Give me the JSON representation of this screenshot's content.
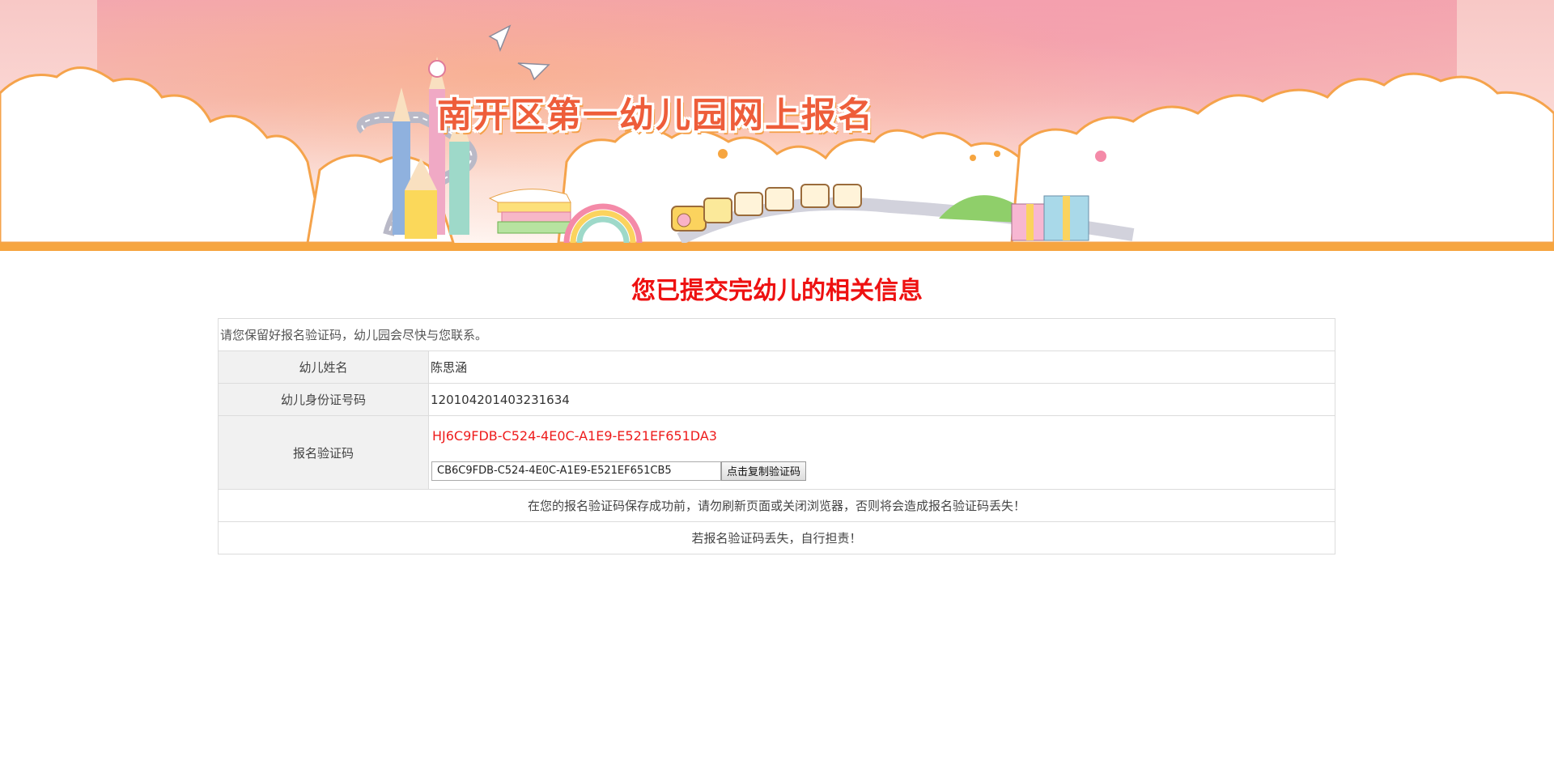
{
  "banner": {
    "title": "南开区第一幼儿园网上报名"
  },
  "page": {
    "heading": "您已提交完幼儿的相关信息",
    "notice": "请您保留好报名验证码，幼儿园会尽快与您联系。"
  },
  "form": {
    "child_name_label": "幼儿姓名",
    "child_name_value": "陈思涵",
    "child_id_label": "幼儿身份证号码",
    "child_id_value": "120104201403231634",
    "code_label": "报名验证码",
    "code_display": "HJ6C9FDB-C524-4E0C-A1E9-E521EF651DA3",
    "code_input_value": "CB6C9FDB-C524-4E0C-A1E9-E521EF651CB5",
    "copy_button_label": "点击复制验证码"
  },
  "warnings": {
    "line1": "在您的报名验证码保存成功前，请勿刷新页面或关闭浏览器，否则将会造成报名验证码丢失！",
    "line2": "若报名验证码丢失，自行担责！"
  },
  "colors": {
    "accent_orange": "#f6a540",
    "heading_red": "#ee1111",
    "code_red": "#ee1c1c",
    "banner_title": "#ee5d3a"
  }
}
